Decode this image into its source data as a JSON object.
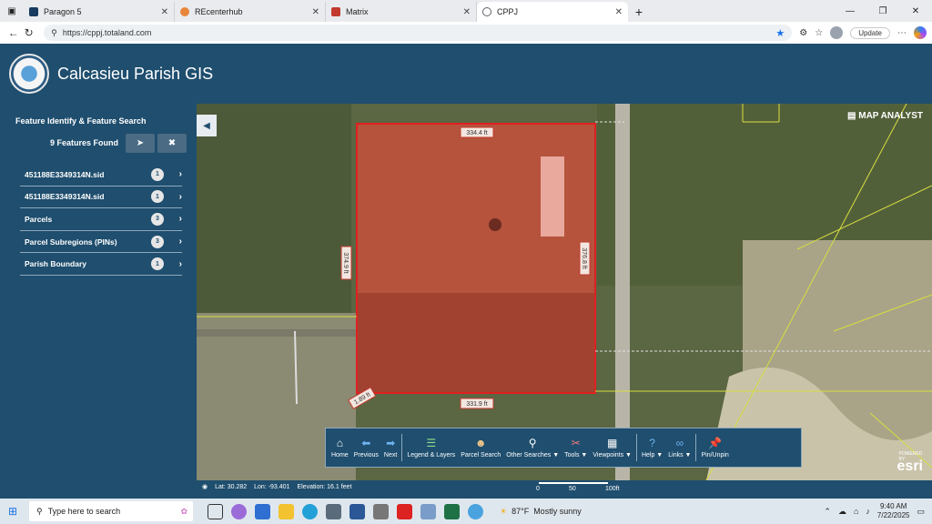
{
  "browser": {
    "tabs": [
      {
        "label": "Paragon 5",
        "color": "#173a5e"
      },
      {
        "label": "REcenterhub",
        "color": "#e8863a"
      },
      {
        "label": "Matrix",
        "color": "#c23b2e"
      },
      {
        "label": "CPPJ",
        "color": "#5f6368"
      }
    ],
    "url": "https://cppj.totaland.com",
    "update_label": "Update"
  },
  "app": {
    "title": "Calcasieu Parish GIS"
  },
  "sidebar": {
    "heading": "Feature Identify & Feature Search",
    "found_text": "9 Features Found",
    "items": [
      {
        "label": "451188E3349314N.sid",
        "count": "1"
      },
      {
        "label": "451188E3349314N.sid",
        "count": "1"
      },
      {
        "label": "Parcels",
        "count": "3"
      },
      {
        "label": "Parcel Subregions (PINs)",
        "count": "3"
      },
      {
        "label": "Parish Boundary",
        "count": "1"
      }
    ]
  },
  "map": {
    "brand": "MAP ANALYST",
    "esri_powered": "POWERED BY",
    "esri_label": "esri",
    "dimensions": {
      "top": "334.4 ft",
      "bottom": "331.9 ft",
      "left": "374.9 ft",
      "right": "376.8 ft",
      "corner": "1.89 ft"
    },
    "status": {
      "lat": "Lat: 30.282",
      "lon": "Lon: -93.401",
      "elevation": "Elevation: 16.1 feet"
    },
    "scale": {
      "ticks": [
        "0",
        "50",
        "100ft"
      ]
    }
  },
  "toolbar": {
    "items": [
      {
        "label": "Home",
        "icon": "home-icon"
      },
      {
        "label": "Previous",
        "icon": "arrow-left-icon"
      },
      {
        "label": "Next",
        "icon": "arrow-right-icon"
      },
      {
        "label": "Legend & Layers",
        "icon": "layers-icon"
      },
      {
        "label": "Parcel Search",
        "icon": "parcel-search-icon"
      },
      {
        "label": "Other Searches ▼",
        "icon": "magnifier-icon"
      },
      {
        "label": "Tools ▼",
        "icon": "wrench-icon"
      },
      {
        "label": "Viewpoints ▼",
        "icon": "grid-icon"
      },
      {
        "label": "Help ▼",
        "icon": "question-icon"
      },
      {
        "label": "Links ▼",
        "icon": "link-icon"
      },
      {
        "label": "Pin/Unpin",
        "icon": "pin-icon"
      }
    ]
  },
  "taskbar": {
    "search_placeholder": "Type here to search",
    "weather_temp": "87°F",
    "weather_text": "Mostly sunny",
    "time": "9:40 AM",
    "date": "7/22/2025"
  }
}
